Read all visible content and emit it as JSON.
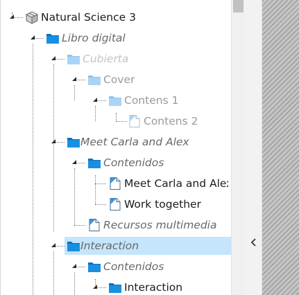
{
  "tree": {
    "root": {
      "label": "Natural Science 3",
      "icon": "package-icon"
    },
    "nodes": [
      {
        "label": "Libro digital",
        "icon": "folder-icon",
        "style": "italic-dim"
      },
      {
        "label": "Cubierta",
        "icon": "folder-icon-light",
        "style": "italic-faded"
      },
      {
        "label": "Cover",
        "icon": "folder-icon-light",
        "style": "faded"
      },
      {
        "label": "Contens 1",
        "icon": "folder-icon-light",
        "style": "faded"
      },
      {
        "label": "Contens 2",
        "icon": "page-icon-light",
        "style": "faded"
      },
      {
        "label": "Meet Carla and Alex",
        "icon": "folder-icon",
        "style": "italic-mid"
      },
      {
        "label": "Contenidos",
        "icon": "folder-icon",
        "style": "italic-mid"
      },
      {
        "label": "Meet Carla and Alex",
        "icon": "page-icon",
        "style": "normal"
      },
      {
        "label": "Work together",
        "icon": "page-icon",
        "style": "normal"
      },
      {
        "label": "Recursos multimedia",
        "icon": "page-icon",
        "style": "italic-mid"
      },
      {
        "label": "Interaction",
        "icon": "folder-icon",
        "style": "italic-mid-selected"
      },
      {
        "label": "Contenidos",
        "icon": "folder-icon",
        "style": "italic-mid"
      },
      {
        "label": "Interaction",
        "icon": "folder-icon",
        "style": "normal"
      }
    ]
  },
  "collapse_panel": {
    "icon": "chevron-left-icon"
  },
  "colors": {
    "folder": "#1a8fe0",
    "folder_light": "#a9d4f5",
    "selection": "#c4e5fb",
    "striped_pane": "#b8b8b8"
  }
}
